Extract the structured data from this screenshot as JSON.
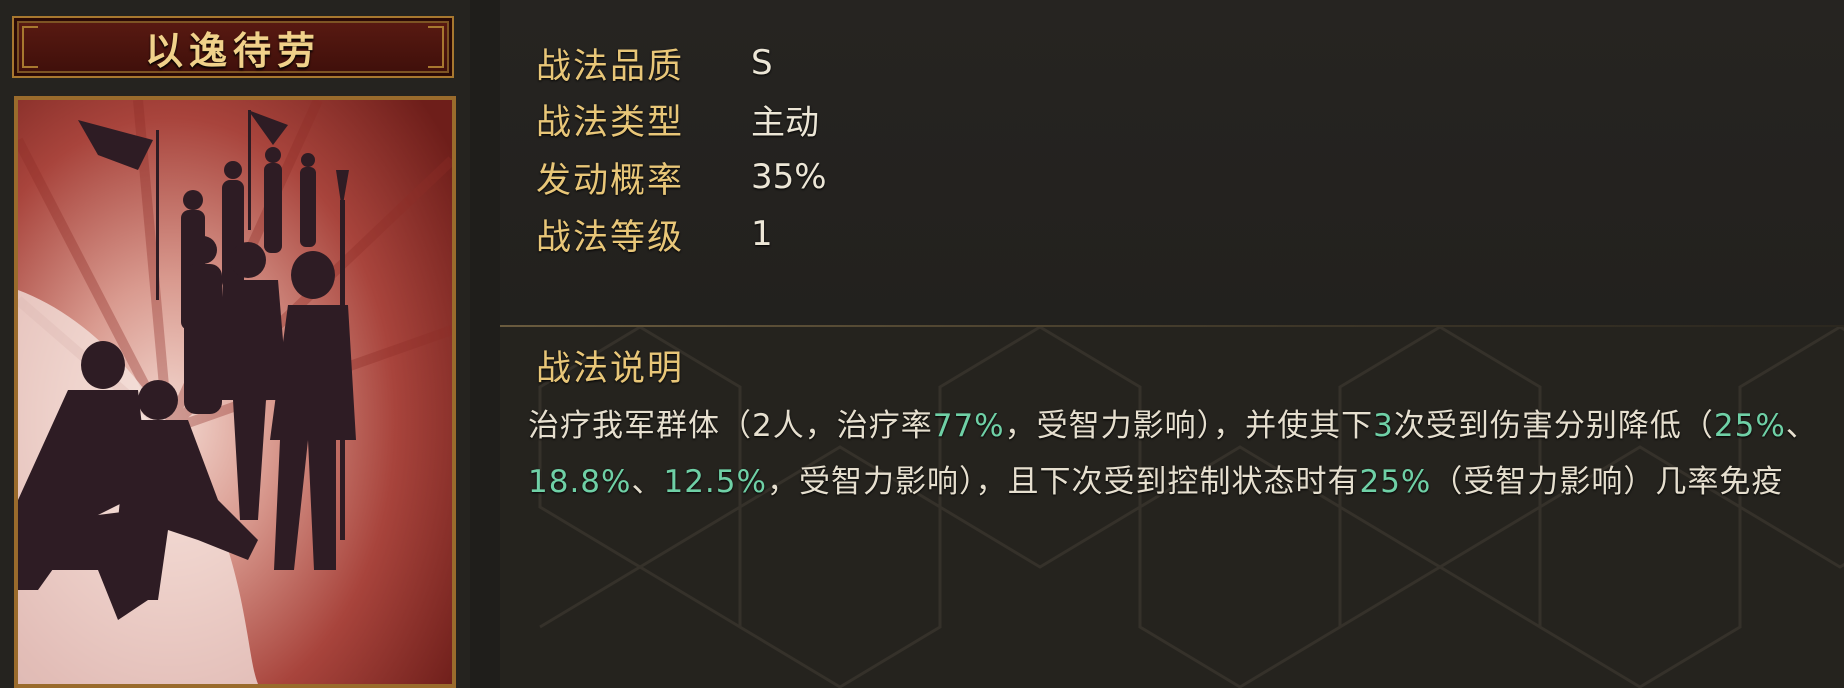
{
  "skill": {
    "name": "以逸待劳",
    "attributes": [
      {
        "label": "战法品质",
        "value": "S"
      },
      {
        "label": "战法类型",
        "value": "主动"
      },
      {
        "label": "发动概率",
        "value": "35%"
      },
      {
        "label": "战法等级",
        "value": "1"
      }
    ],
    "description_title": "战法说明",
    "description_parts": [
      {
        "text": "治疗我军群体（2人，治疗率",
        "highlight": false
      },
      {
        "text": "77%",
        "highlight": true
      },
      {
        "text": "，受智力影响），并使其下",
        "highlight": false
      },
      {
        "text": "3",
        "highlight": true
      },
      {
        "text": "次受到伤害分别降低（",
        "highlight": false
      },
      {
        "text": "25%",
        "highlight": true
      },
      {
        "text": "、",
        "highlight": false
      },
      {
        "text": "18.8%",
        "highlight": true
      },
      {
        "text": "、",
        "highlight": false
      },
      {
        "text": "12.5%",
        "highlight": true
      },
      {
        "text": "，受智力影响），且下次受到控制状态时有",
        "highlight": false
      },
      {
        "text": "25%",
        "highlight": true
      },
      {
        "text": "（受智力影响）几率免疫",
        "highlight": false
      }
    ]
  },
  "colors": {
    "label_gold": "#e8c678",
    "value_white": "#ece6d6",
    "highlight_green": "#6fd0a6",
    "banner_red": "#5a1a12"
  }
}
